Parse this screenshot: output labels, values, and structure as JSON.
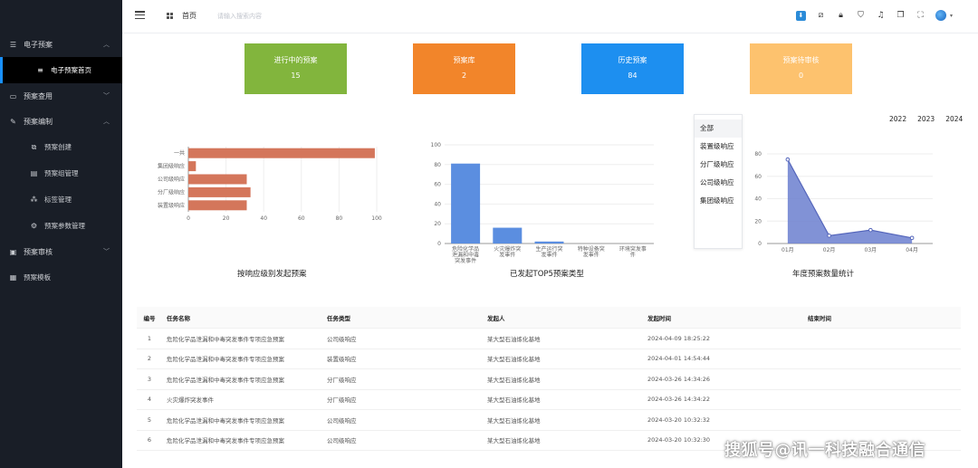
{
  "sidebar": {
    "groups": [
      {
        "label": "电子预案",
        "icon": "list-icon"
      },
      {
        "label": "预案查用",
        "icon": "monitor-icon"
      },
      {
        "label": "预案编制",
        "icon": "edit-icon"
      },
      {
        "label": "预案审核",
        "icon": "approve-icon"
      }
    ],
    "items": [
      {
        "label": "电子预案首页",
        "icon": "bars-icon"
      },
      {
        "label": "预案创建",
        "icon": "create-icon"
      },
      {
        "label": "预案组管理",
        "icon": "group-icon"
      },
      {
        "label": "标签管理",
        "icon": "tag-icon"
      },
      {
        "label": "预案参数管理",
        "icon": "gear-icon"
      },
      {
        "label": "预案模板",
        "icon": "template-icon"
      }
    ]
  },
  "header": {
    "home_label": "首页",
    "search_placeholder": "请输入搜索内容"
  },
  "stats": [
    {
      "label": "进行中的预案",
      "value": "15",
      "color": "#82b53d"
    },
    {
      "label": "预案库",
      "value": "2",
      "color": "#f2852a"
    },
    {
      "label": "历史预案",
      "value": "84",
      "color": "#1d8ff0"
    },
    {
      "label": "预案待审核",
      "value": "0",
      "color": "#fdc26e"
    }
  ],
  "charts": {
    "bar_h_title": "按响应级别发起预案",
    "bar_v_title": "已发起TOP5预案类型",
    "line_title": "年度预案数量统计"
  },
  "chart_data": [
    {
      "type": "bar",
      "orientation": "horizontal",
      "categories": [
        "一共",
        "集团级响应",
        "公司级响应",
        "分厂级响应",
        "装置级响应"
      ],
      "values": [
        99,
        4,
        31,
        33,
        31
      ],
      "xlim": [
        0,
        100
      ],
      "xticks": [
        "0",
        "20",
        "40",
        "60",
        "80",
        "100"
      ],
      "color": "#d4765b"
    },
    {
      "type": "bar",
      "categories": [
        [
          "危险化学品",
          "泄漏和中毒",
          "突发事件"
        ],
        [
          "火灾爆炸突",
          "发事件"
        ],
        [
          "生产运行突",
          "发事件"
        ],
        [
          "特种设备突",
          "发事件"
        ],
        [
          "环境突发事",
          "件"
        ]
      ],
      "values": [
        81,
        16,
        2,
        0,
        0
      ],
      "ylim": [
        0,
        100
      ],
      "yticks": [
        "0",
        "20",
        "40",
        "60",
        "80",
        "100"
      ],
      "color": "#5b8ee0"
    },
    {
      "type": "area",
      "categories": [
        "01月",
        "02月",
        "03月",
        "04月"
      ],
      "values": [
        75,
        7,
        12,
        5
      ],
      "ylim": [
        0,
        80
      ],
      "yticks": [
        "0",
        "20",
        "40",
        "60",
        "80"
      ],
      "color": "#6b7fcf"
    }
  ],
  "filter": {
    "items": [
      "全部",
      "装置级响应",
      "分厂级响应",
      "公司级响应",
      "集团级响应"
    ]
  },
  "years": [
    "2022",
    "2023",
    "2024"
  ],
  "table": {
    "headers": [
      "编号",
      "任务名称",
      "任务类型",
      "发起人",
      "发起时间",
      "结束时间"
    ],
    "rows": [
      [
        "1",
        "危险化学品泄漏和中毒突发事件专项应急预案",
        "公司级响应",
        "某大型石油炼化基地",
        "2024-04-09 18:25:22",
        ""
      ],
      [
        "2",
        "危险化学品泄漏和中毒突发事件专项应急预案",
        "装置级响应",
        "某大型石油炼化基地",
        "2024-04-01 14:54:44",
        ""
      ],
      [
        "3",
        "危险化学品泄漏和中毒突发事件专项应急预案",
        "分厂级响应",
        "某大型石油炼化基地",
        "2024-03-26 14:34:26",
        ""
      ],
      [
        "4",
        "火灾爆炸突发事件",
        "分厂级响应",
        "某大型石油炼化基地",
        "2024-03-26 14:34:22",
        ""
      ],
      [
        "5",
        "危险化学品泄漏和中毒突发事件专项应急预案",
        "公司级响应",
        "某大型石油炼化基地",
        "2024-03-20 10:32:32",
        ""
      ],
      [
        "6",
        "危险化学品泄漏和中毒突发事件专项应急预案",
        "公司级响应",
        "某大型石油炼化基地",
        "2024-03-20 10:32:30",
        ""
      ]
    ]
  },
  "watermark": "搜狐号@讯一科技融合通信"
}
